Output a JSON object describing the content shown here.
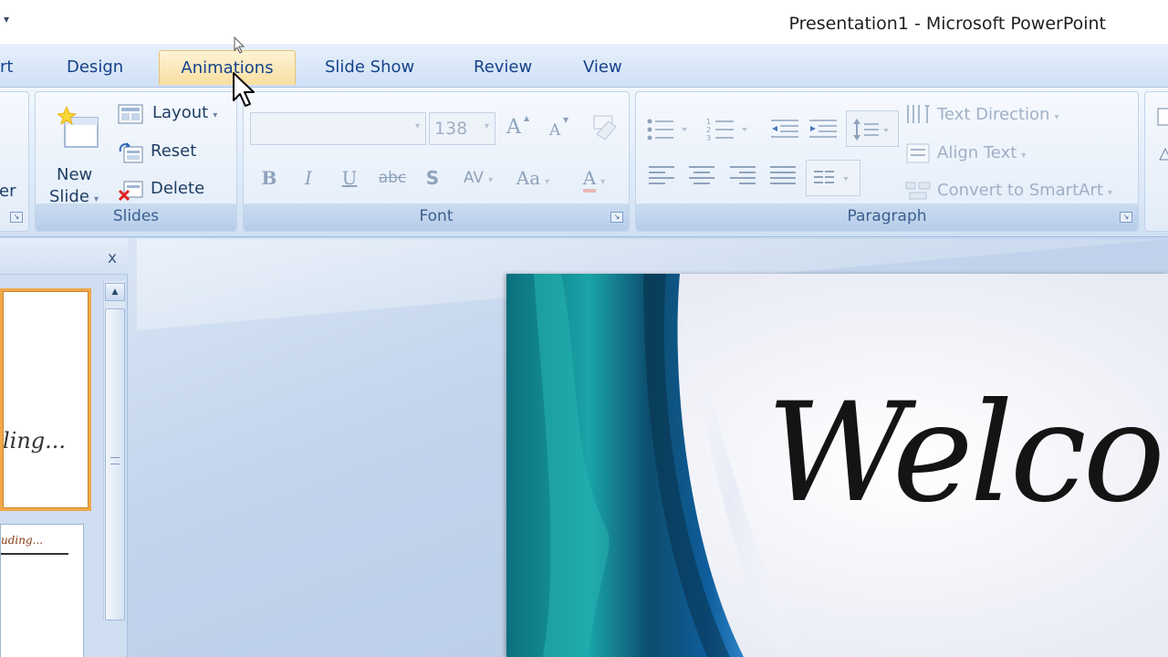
{
  "window": {
    "title": "Presentation1 - Microsoft PowerPoint"
  },
  "tabs": [
    {
      "label": "rt"
    },
    {
      "label": "Design"
    },
    {
      "label": "Animations"
    },
    {
      "label": "Slide Show"
    },
    {
      "label": "Review"
    },
    {
      "label": "View"
    }
  ],
  "ribbon": {
    "left_partial": {
      "label": "er"
    },
    "slides": {
      "group_label": "Slides",
      "new_slide_line1": "New",
      "new_slide_line2": "Slide",
      "layout": "Layout",
      "reset": "Reset",
      "delete": "Delete"
    },
    "font": {
      "group_label": "Font",
      "font_size": "138",
      "bold": "B",
      "italic": "I",
      "underline": "U",
      "strikethrough": "abc",
      "shadow": "S",
      "spacing": "AV",
      "change_case": "Aa",
      "grow": "A",
      "shrink": "A",
      "color": "A"
    },
    "paragraph": {
      "group_label": "Paragraph",
      "text_direction": "Text Direction",
      "align_text": "Align Text",
      "convert_smartart": "Convert to SmartArt"
    }
  },
  "thumbnails": {
    "close": "x",
    "thumb1_text": "ling...",
    "thumb2_text": "uding..."
  },
  "slide": {
    "title_text": "Welcom"
  },
  "colors": {
    "accent": "#15428b",
    "selected_thumb": "#f1a84a"
  }
}
